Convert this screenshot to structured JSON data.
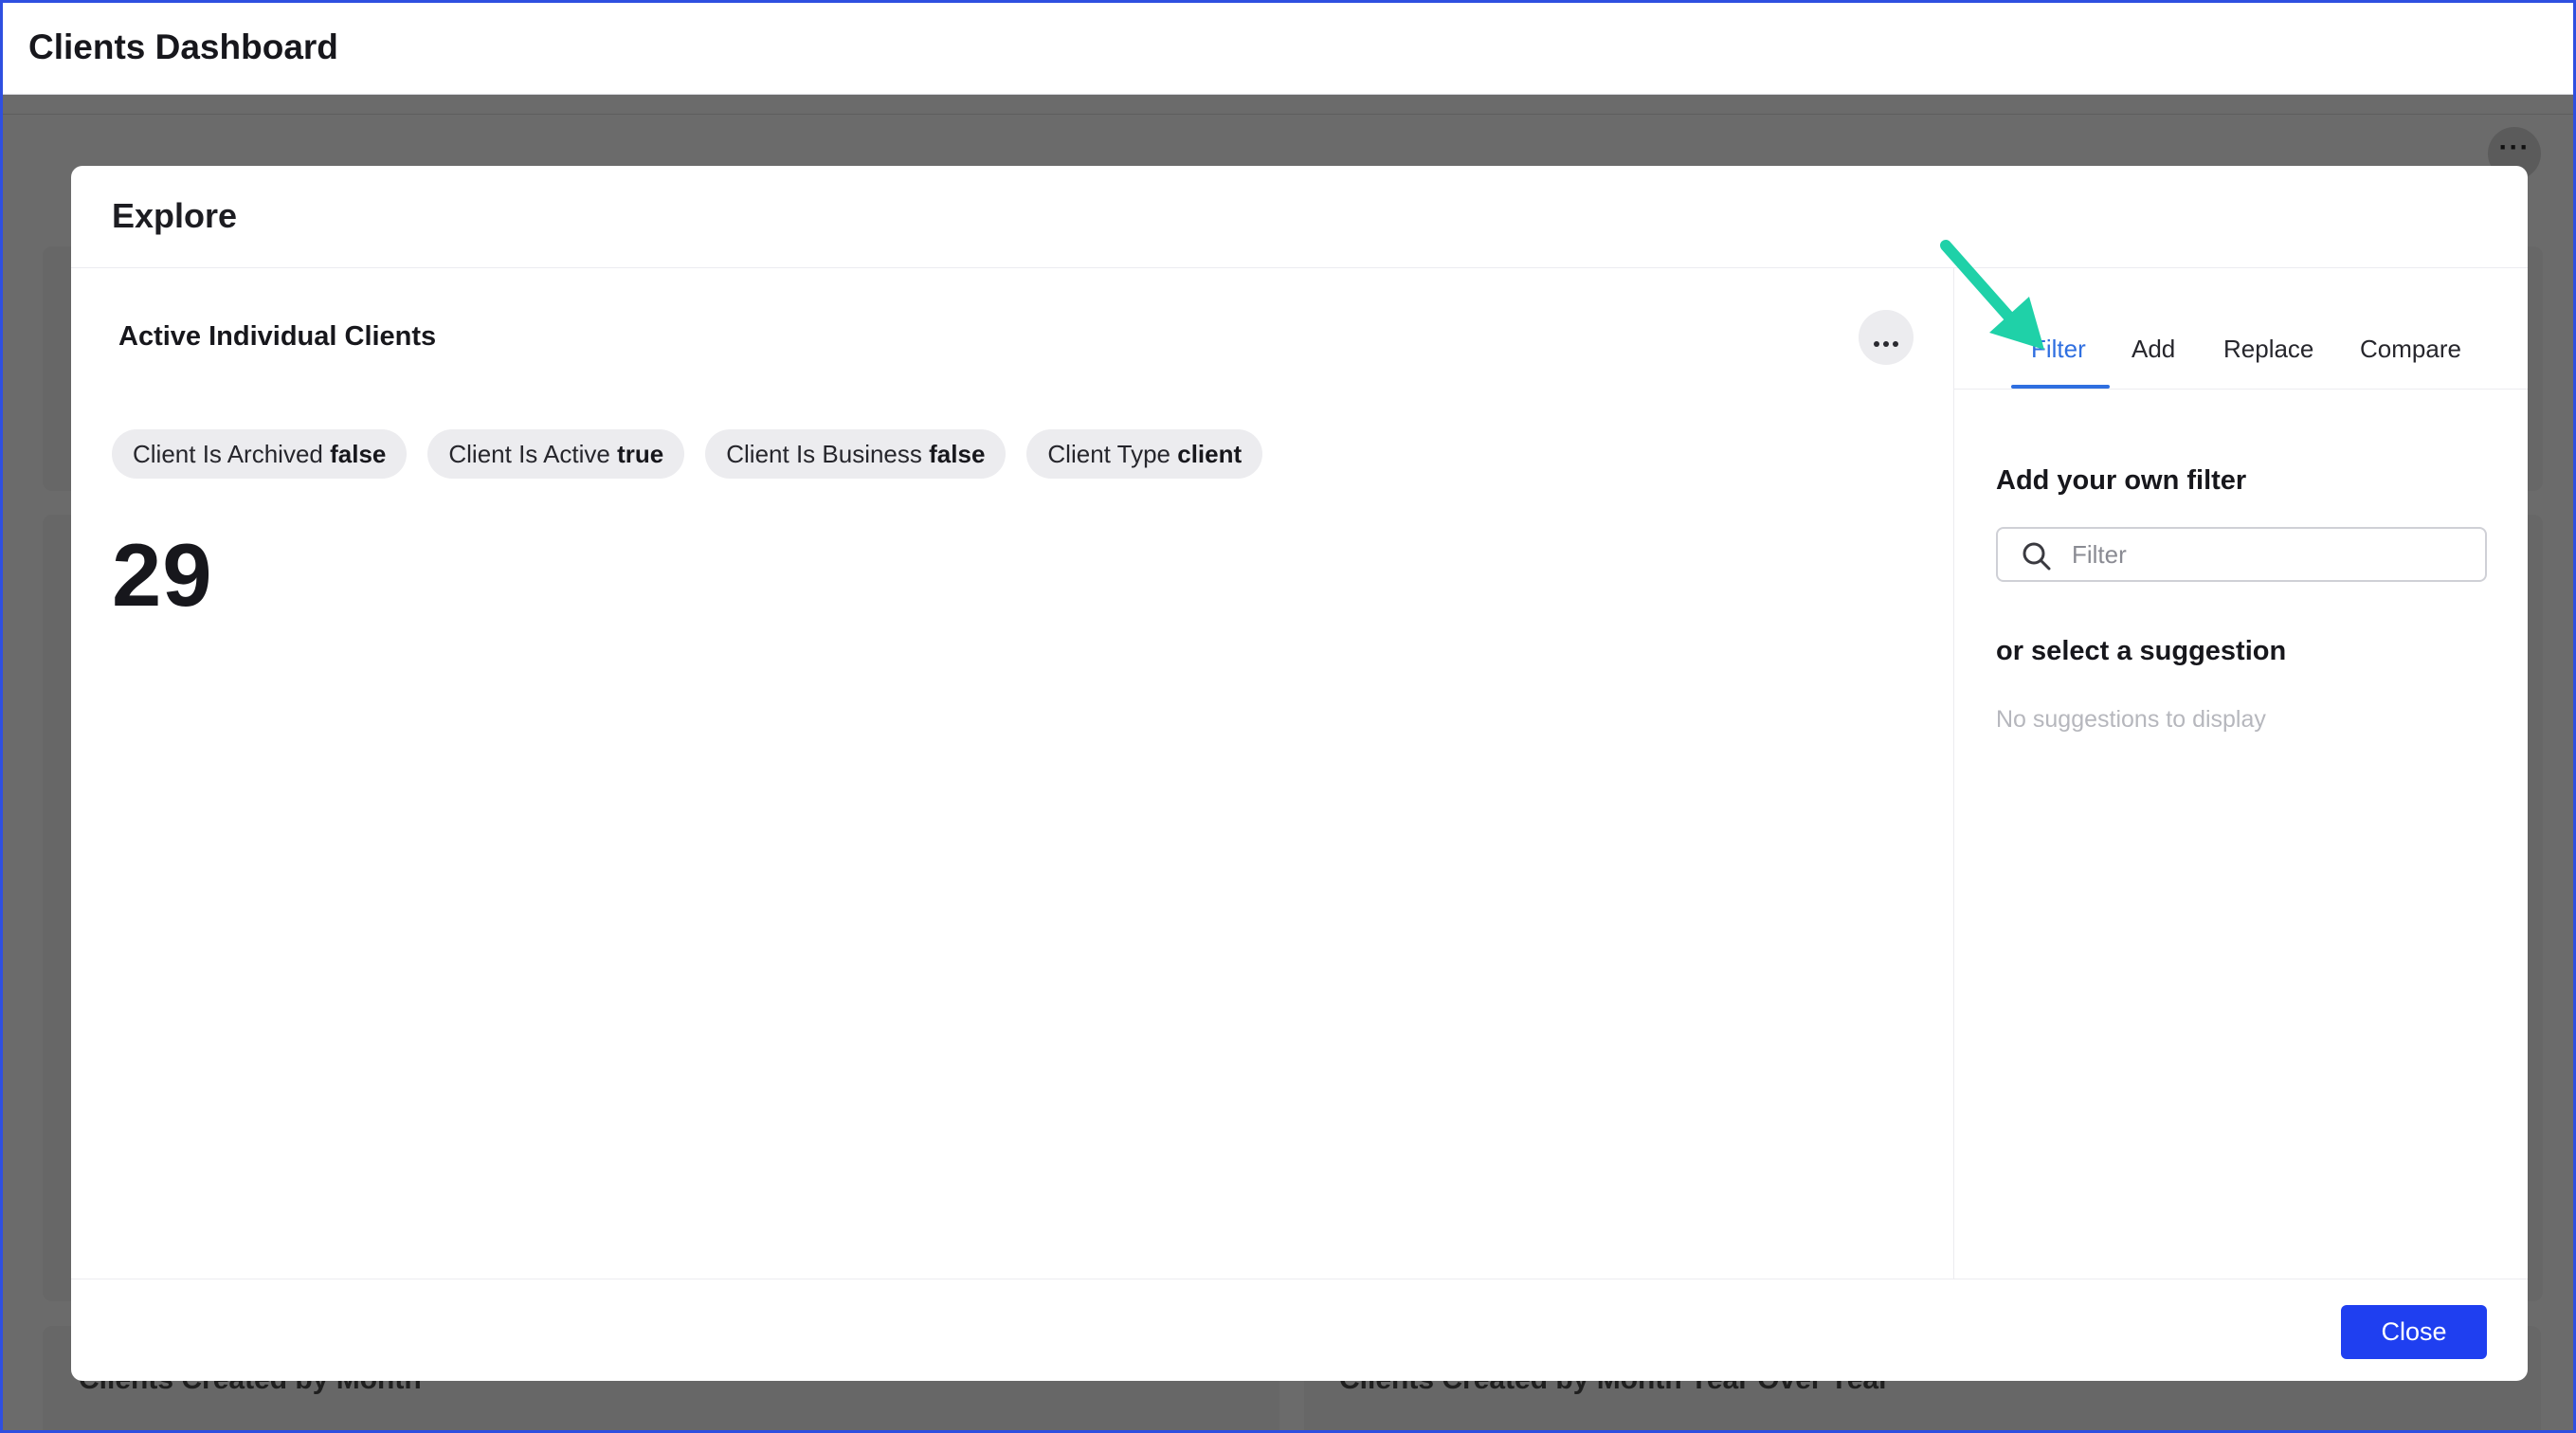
{
  "app": {
    "title": "Clients Dashboard"
  },
  "background": {
    "card_titles": [
      "Clients Created by Month",
      "Clients Created by Month Year Over Year"
    ]
  },
  "modal": {
    "title": "Explore",
    "card": {
      "title": "Active Individual Clients",
      "metric_value": "29",
      "filter_chips": [
        {
          "label": "Client Is Archived",
          "value": "false"
        },
        {
          "label": "Client Is Active",
          "value": "true"
        },
        {
          "label": "Client Is Business",
          "value": "false"
        },
        {
          "label": "Client Type",
          "value": "client"
        }
      ]
    },
    "side_panel": {
      "tabs": [
        {
          "label": "Filter",
          "active": true
        },
        {
          "label": "Add",
          "active": false
        },
        {
          "label": "Replace",
          "active": false
        },
        {
          "label": "Compare",
          "active": false
        }
      ],
      "filter_heading": "Add your own filter",
      "filter_placeholder": "Filter",
      "suggestion_heading": "or select a suggestion",
      "suggestion_empty": "No suggestions to display"
    },
    "footer": {
      "close_label": "Close"
    }
  },
  "colors": {
    "accent": "#2f6fe0",
    "primary_button": "#1f3ff0",
    "annotation_arrow": "#1fd1a8",
    "backdrop": "#6b6b6b"
  },
  "icons": [
    "more-horizontal-icon",
    "search-icon",
    "pointer-arrow-icon"
  ]
}
